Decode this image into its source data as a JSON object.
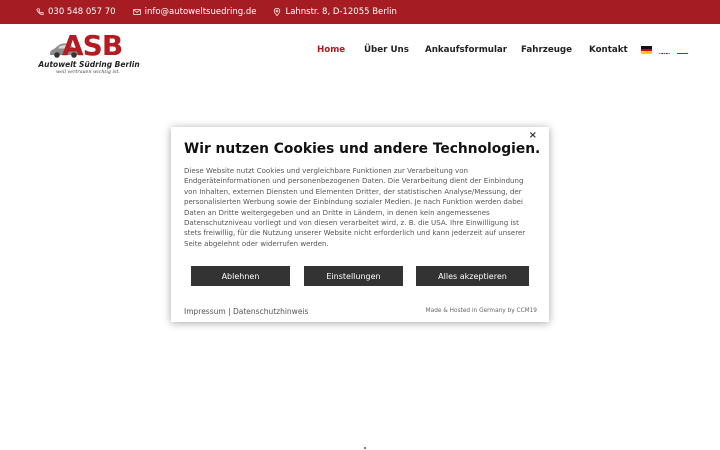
{
  "topbar": {
    "phone": "030 548 057 70",
    "email": "info@autoweltsuedring.de",
    "address": "Lahnstr. 8, D-12055 Berlin"
  },
  "logo": {
    "letters": "ASB",
    "name": "Autowelt Südring Berlin",
    "slogan": "weil vertrauen wichtig ist."
  },
  "nav": {
    "items": [
      "Home",
      "Über Uns",
      "Ankaufsformular",
      "Fahrzeuge",
      "Kontakt"
    ]
  },
  "languages": [
    "de-flag-icon",
    "uk-flag-icon",
    "tr-flag-icon"
  ],
  "cookie_modal": {
    "close": "×",
    "title": "Wir nutzen Cookies und andere Technologien.",
    "body": "Diese Website nutzt Cookies und vergleichbare Funktionen zur Verarbeitung von Endgeräteinformationen und personenbezogenen Daten. Die Verarbeitung dient der Einbindung von Inhalten, externen Diensten und Elementen Dritter, der statistischen Analyse/Messung, der personalisierten Werbung sowie der Einbindung sozialer Medien. Je nach Funktion werden dabei Daten an Dritte weitergegeben und an Dritte in Ländern, in denen kein angemessenes Datenschutzniveau vorliegt und von diesen verarbeitet wird, z. B. die USA. Ihre Einwilligung ist stets freiwillig, für die Nutzung unserer Website nicht erforderlich und kann jederzeit auf unserer Seite abgelehnt oder widerrufen werden.",
    "buttons": {
      "reject": "Ablehnen",
      "settings": "Einstellungen",
      "accept": "Alles akzeptieren"
    },
    "imprint": "Impressum",
    "separator": "|",
    "privacy": "Datenschutzhinweis",
    "credit": "Made & Hosted in Germany by CCM19"
  },
  "colors": {
    "brand_red": "#a51d22",
    "button_dark": "#333333"
  }
}
